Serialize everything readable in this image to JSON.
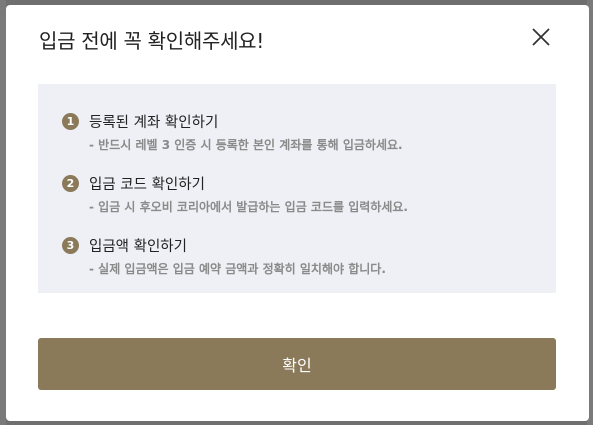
{
  "colors": {
    "accent": "#8b7a5a",
    "notice_bg": "#eff0f5",
    "title_text": "#222222",
    "desc_text": "#8a8a8a"
  },
  "modal": {
    "title": "입금 전에 꼭 확인해주세요!",
    "close_icon": "close-icon",
    "items": [
      {
        "number": "1",
        "title": "등록된 계좌 확인하기",
        "description": "- 반드시 레벨 3 인증 시 등록한 본인 계좌를 통해 입금하세요."
      },
      {
        "number": "2",
        "title": "입금 코드 확인하기",
        "description": "- 입금 시 후오비 코리아에서 발급하는 입금 코드를 입력하세요."
      },
      {
        "number": "3",
        "title": "입금액 확인하기",
        "description": "- 실제 입금액은 입금 예약 금액과 정확히 일치해야 합니다."
      }
    ],
    "confirm_label": "확인"
  }
}
